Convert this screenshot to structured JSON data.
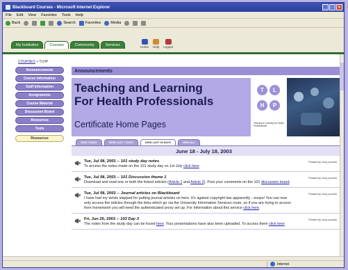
{
  "window": {
    "title": "Blackboard Courses - Microsoft Internet Explorer"
  },
  "menubar": {
    "items": [
      "File",
      "Edit",
      "View",
      "Favorites",
      "Tools",
      "Help"
    ]
  },
  "toolbar": {
    "back": "Back",
    "search": "Search",
    "favorites": "Favorites",
    "media": "Media"
  },
  "bb": {
    "tabs": [
      "My Institution",
      "Courses",
      "Community",
      "Services"
    ],
    "active_tab": "Courses",
    "icons": [
      "Home",
      "Help",
      "Logout"
    ]
  },
  "breadcrumb": {
    "link": "COURSES",
    "current": "> TLHP"
  },
  "sidebar": {
    "items": [
      "Announcements",
      "Course Information",
      "Staff Information",
      "Assignments",
      "Course Material",
      "Discussion Board",
      "Resources",
      "Tools"
    ],
    "selected": "Resources"
  },
  "content": {
    "header": "Announcements",
    "banner": {
      "title_line1": "Teaching and Learning",
      "title_line2": "For Health Professionals",
      "subtitle": "Certificate Home Pages",
      "logo_letters": [
        "T",
        "L",
        "H",
        "P"
      ],
      "logo_caption": "Teaching & Learning for Health Professionals"
    },
    "view_tabs": [
      "VIEW TODAY",
      "VIEW LAST 7 DAYS",
      "VIEW LAST 30 DAYS",
      "VIEW ALL"
    ],
    "active_view": "VIEW LAST 30 DAYS",
    "date_range": "June 18 - July 18, 2003",
    "announcements": [
      {
        "date": "Tue, Jul 08, 2003",
        "title": "101 study day notes",
        "body": "To access the notes made on the 101 study day on 1st July",
        "link": "click here",
        "posted_by": "Posted by: lucy pocock"
      },
      {
        "date": "Tue, Jul 08, 2003",
        "title": "101 Discussion theme 1",
        "body1": "Download and read one or both the linked articles (",
        "link1": "Article 1",
        "mid": " and ",
        "link2": "Article 2",
        "body2": "). Post your comments on the 101 ",
        "link3": "discussion board",
        "posted_by": "Posted by: lucy pocock"
      },
      {
        "date": "Tue, Jul 08, 2003",
        "title": "Journal articles on Blackboard",
        "body": "I have had my wrists slapped for putting journal articles on here. It's against copyright law apparently - ooops! You can now only access the articles through the links which go via the University Information Services route, so if you are trying to access from home/work you will need the authenticated proxy set up. For information about this service",
        "link": "click here",
        "posted_by": "Posted by: lucy pocock"
      },
      {
        "date": "Fri, Jun 20, 2003",
        "title": "103 Day 3",
        "body1": "The notes from the study day can be found ",
        "link1": "here",
        "body2": ". Your presentations have also been uploaded. To access them ",
        "link2": "click here",
        "posted_by": "Posted by: lucy pocock"
      }
    ]
  },
  "status": {
    "zone": "Internet"
  },
  "colors": {
    "accent_purple": "#9a8fd4",
    "bb_green": "#2f6e2f"
  }
}
